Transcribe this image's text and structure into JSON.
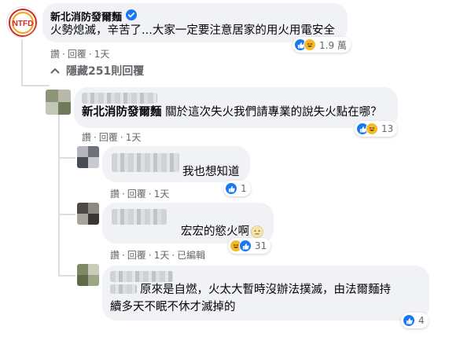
{
  "top_comment": {
    "author": "新北消防發爾麵",
    "text": "火勢熄滅，辛苦了...大家一定要注意居家的用火用電安全",
    "actions": [
      "讚",
      "回覆",
      "1天"
    ],
    "reaction_count": "1.9 萬",
    "logo_text": "NTFD"
  },
  "hidden_replies_label": "隱藏251則回覆",
  "replies": [
    {
      "mention": "新北消防發爾麵",
      "text": " 關於這次失火我們請專業的說失火點在哪？",
      "actions": [
        "讚",
        "回覆",
        "1天"
      ],
      "reaction_count": "13"
    },
    {
      "text": "我也想知道",
      "actions": [
        "讚",
        "回覆",
        "1天"
      ],
      "reaction_count": "1"
    },
    {
      "text": "宏宏的慾火啊",
      "actions": [
        "讚",
        "回覆",
        "1天",
        "已編輯"
      ],
      "reaction_count": "31"
    },
    {
      "text_line1": "原來是自燃，火太大暫時沒辦法撲滅，由法爾麵持",
      "text_line2": "續多天不眠不休才滅掉的",
      "reaction_count": "4"
    }
  ],
  "colors": {
    "bubble": "#f0f2f5",
    "like": "#1877f2",
    "haha": "#f7b928",
    "verified": "#1877f2",
    "logo_red": "#d7261e"
  }
}
